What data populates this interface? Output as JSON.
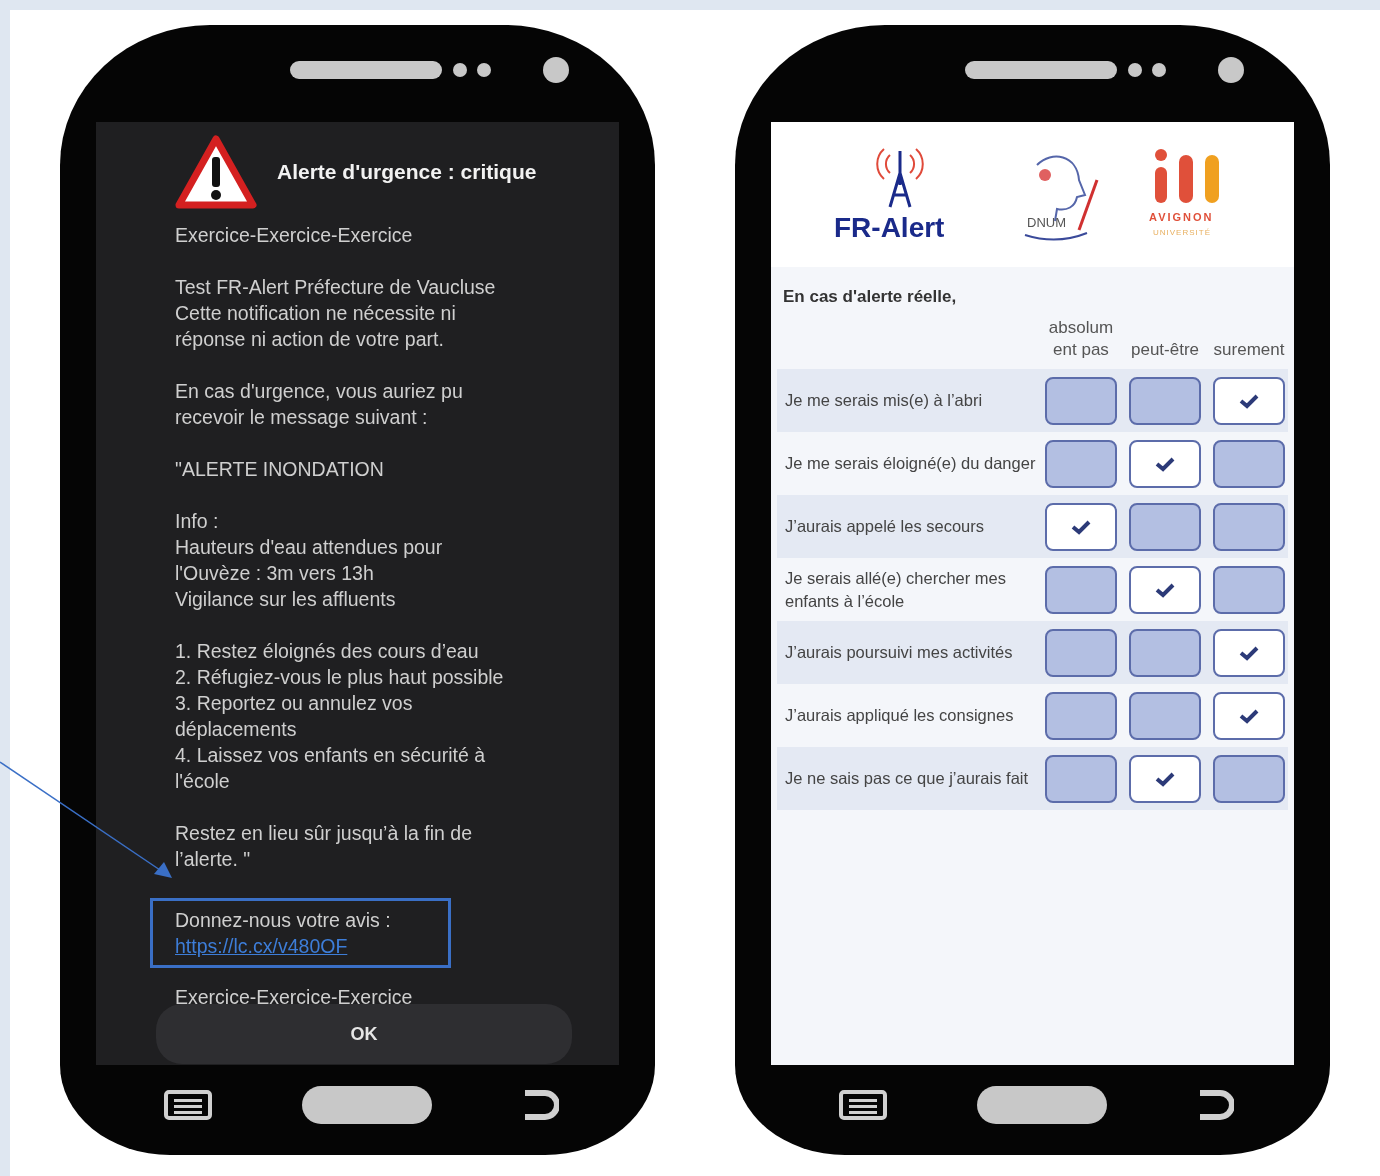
{
  "alert_phone": {
    "title": "Alerte d'urgence : critique",
    "paragraphs": [
      "Exercice-Exercice-Exercice",
      "Test FR-Alert Préfecture de Vaucluse\nCette notification ne nécessite ni\nréponse ni action de votre part.",
      "En cas d'urgence, vous auriez pu\nrecevoir le message suivant :",
      "\"ALERTE INONDATION",
      "Info :\nHauteurs d'eau attendues pour\nl'Ouvèze : 3m vers 13h\nVigilance sur les affluents",
      "1. Restez éloignés des cours d’eau\n2. Réfugiez-vous le plus haut possible\n3. Reportez ou annulez vos\ndéplacements\n4. Laissez vos enfants en sécurité à\nl'école",
      "Restez en lieu sûr jusqu’à la fin de\nl’alerte. \""
    ],
    "feedback": {
      "text": "Donnez-nous votre avis :",
      "link": "https://lc.cx/v480OF"
    },
    "footer": "Exercice-Exercice-Exercice",
    "button": "OK"
  },
  "survey_phone": {
    "logos": {
      "fr_alert": "FR-Alert",
      "dnum": "DNUM",
      "avignon": "AVIGNON",
      "avignon_sub": "UNIVERSITÉ"
    },
    "heading": "En cas d'alerte réelle,",
    "columns": [
      "absolum\nent pas",
      "peut-être",
      "surement"
    ],
    "rows": [
      {
        "label": "Je me serais mis(e) à l’abri",
        "choices": [
          {
            "selected": false
          },
          {
            "selected": false
          },
          {
            "selected": true
          }
        ]
      },
      {
        "label": "Je me serais éloigné(e) du danger",
        "choices": [
          {
            "selected": false
          },
          {
            "selected": true
          },
          {
            "selected": false
          }
        ]
      },
      {
        "label": "J’aurais appelé les secours",
        "choices": [
          {
            "selected": true
          },
          {
            "selected": false
          },
          {
            "selected": false
          }
        ]
      },
      {
        "label": "Je serais allé(e) chercher mes enfants à l’école",
        "choices": [
          {
            "selected": false
          },
          {
            "selected": true
          },
          {
            "selected": false
          }
        ]
      },
      {
        "label": "J’aurais poursuivi mes activités",
        "choices": [
          {
            "selected": false
          },
          {
            "selected": false
          },
          {
            "selected": true
          }
        ]
      },
      {
        "label": "J’aurais appliqué les consignes",
        "choices": [
          {
            "selected": false
          },
          {
            "selected": false
          },
          {
            "selected": true
          }
        ]
      },
      {
        "label": "Je ne sais pas ce que j’aurais fait",
        "choices": [
          {
            "selected": false
          },
          {
            "selected": true
          },
          {
            "selected": false
          }
        ]
      }
    ]
  }
}
